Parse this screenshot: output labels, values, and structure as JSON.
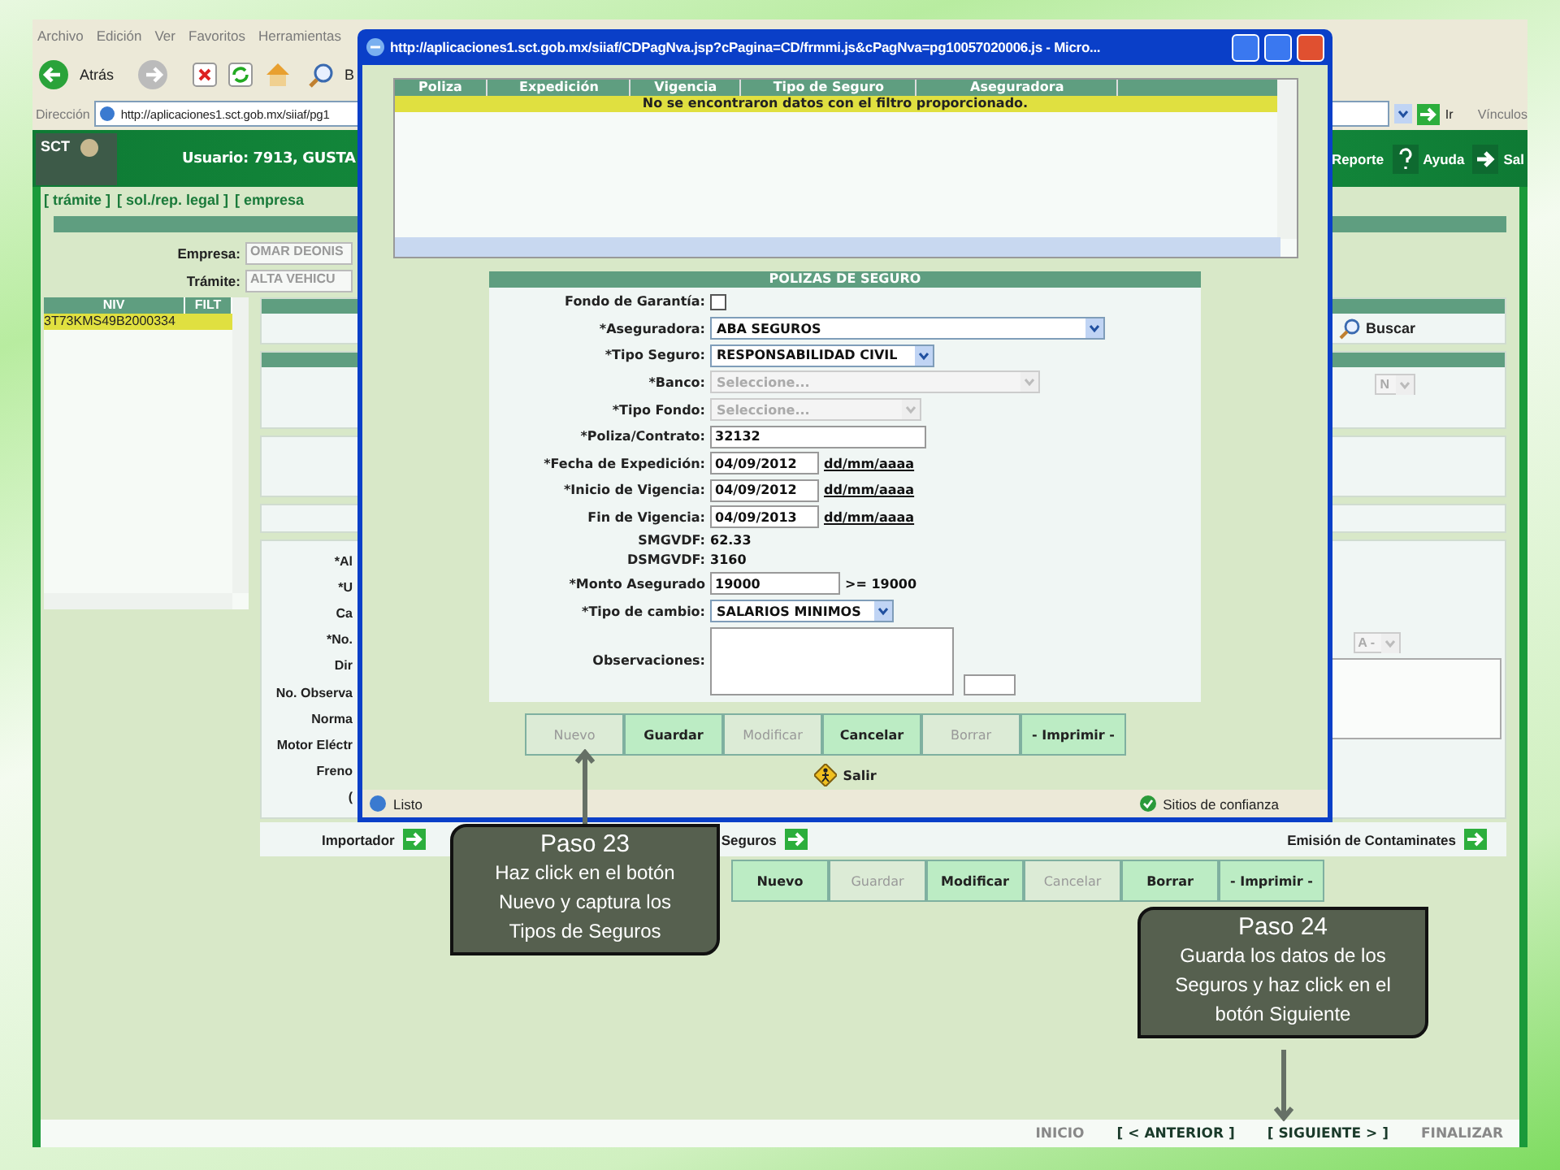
{
  "browser": {
    "menu": [
      "Archivo",
      "Edición",
      "Ver",
      "Favoritos",
      "Herramientas"
    ],
    "back_label": "Atrás",
    "search_label": "B",
    "address_label": "Dirección",
    "url": "http://aplicaciones1.sct.gob.mx/siiaf/pg1",
    "go_label": "Ir",
    "links_label": "Vínculos"
  },
  "header": {
    "logo": "SCT",
    "user": "Usuario: 7913, GUSTA",
    "actions": [
      {
        "label": "Reporte"
      },
      {
        "label": "Ayuda"
      },
      {
        "label": "Sal"
      }
    ]
  },
  "nav": [
    "[ trámite ]",
    "[ sol./rep. legal ]",
    "[ empresa"
  ],
  "fields": [
    {
      "label": "Empresa:",
      "value": "OMAR DEONIS",
      "disabled": true
    },
    {
      "label": "Trámite:",
      "value": "ALTA VEHICU",
      "disabled": true
    }
  ],
  "niv_list": {
    "columns": [
      "NIV",
      "FILT"
    ],
    "rows": [
      {
        "niv": "3T73KMS49B2000334",
        "selected": true
      }
    ]
  },
  "search_label": "Buscar",
  "select_stubs": [
    "N",
    "A -"
  ],
  "detail_labels": [
    "*Al",
    "*U",
    "Ca",
    "*No.",
    "Dir",
    "No. Observa",
    "Norma",
    "Motor Eléctr",
    "Freno",
    "("
  ],
  "links_bar": [
    {
      "label": "Importador"
    },
    {
      "label": "Seguros"
    },
    {
      "label": "Emisión de Contaminates"
    }
  ],
  "page_buttons": [
    {
      "label": "Nuevo",
      "disabled": false
    },
    {
      "label": "Guardar",
      "disabled": true
    },
    {
      "label": "Modificar",
      "disabled": false
    },
    {
      "label": "Cancelar",
      "disabled": true
    },
    {
      "label": "Borrar",
      "disabled": false
    },
    {
      "label": "- Imprimir -",
      "disabled": false
    }
  ],
  "footer_nav": [
    {
      "label": "INICIO",
      "disabled": true
    },
    {
      "label": "[ < ANTERIOR ]",
      "disabled": false
    },
    {
      "label": "[ SIGUIENTE > ]",
      "disabled": false
    },
    {
      "label": "FINALIZAR",
      "disabled": true
    }
  ],
  "popup": {
    "title": "http://aplicaciones1.sct.gob.mx/siiaf/CDPagNva.jsp?cPagina=CD/frmmi.js&cPagNva=pg10057020006.js - Micro...",
    "table": {
      "columns": [
        "Poliza",
        "Expedición",
        "Vigencia",
        "Tipo de Seguro",
        "Aseguradora"
      ],
      "message": "No se encontraron datos con el filtro proporcionado."
    },
    "form": {
      "title": "POLIZAS DE SEGURO",
      "rows": [
        {
          "kind": "checkbox",
          "label": "Fondo de Garantía:",
          "checked": false
        },
        {
          "kind": "select",
          "label": "*Aseguradora:",
          "value": "ABA SEGUROS",
          "disabled": false
        },
        {
          "kind": "select",
          "label": "*Tipo Seguro:",
          "value": "RESPONSABILIDAD CIVIL",
          "disabled": false
        },
        {
          "kind": "select",
          "label": "*Banco:",
          "value": "Seleccione...",
          "disabled": true
        },
        {
          "kind": "select",
          "label": "*Tipo Fondo:",
          "value": "Seleccione...",
          "disabled": true
        },
        {
          "kind": "text",
          "label": "*Poliza/Contrato:",
          "value": "32132"
        },
        {
          "kind": "date",
          "label": "*Fecha de Expedición:",
          "value": "04/09/2012",
          "hint": "dd/mm/aaaa"
        },
        {
          "kind": "date",
          "label": "*Inicio de Vigencia:",
          "value": "04/09/2012",
          "hint": "dd/mm/aaaa"
        },
        {
          "kind": "date",
          "label": "Fin de Vigencia:",
          "value": "04/09/2013",
          "hint": "dd/mm/aaaa"
        },
        {
          "kind": "static",
          "label": "SMGVDF:",
          "value": "62.33"
        },
        {
          "kind": "static",
          "label": "DSMGVDF:",
          "value": "3160"
        },
        {
          "kind": "amount",
          "label": "*Monto Asegurado",
          "value": "19000",
          "note": ">= 19000"
        },
        {
          "kind": "select",
          "label": "*Tipo de cambio:",
          "value": "SALARIOS MINIMOS",
          "disabled": false
        },
        {
          "kind": "textarea",
          "label": "Observaciones:"
        }
      ]
    },
    "buttons": [
      {
        "label": "Nuevo",
        "disabled": true
      },
      {
        "label": "Guardar",
        "disabled": false
      },
      {
        "label": "Modificar",
        "disabled": true
      },
      {
        "label": "Cancelar",
        "disabled": false
      },
      {
        "label": "Borrar",
        "disabled": true
      },
      {
        "label": "- Imprimir -",
        "disabled": false
      }
    ],
    "exit_label": "Salir",
    "status": "Listo",
    "zone": "Sitios de confianza"
  },
  "callouts": [
    {
      "title": "Paso 23",
      "text": "Haz click en el botón Nuevo y captura los Tipos de Seguros"
    },
    {
      "title": "Paso 24",
      "text": "Guarda los datos de los Seguros y haz click en el botón  Siguiente"
    }
  ]
}
